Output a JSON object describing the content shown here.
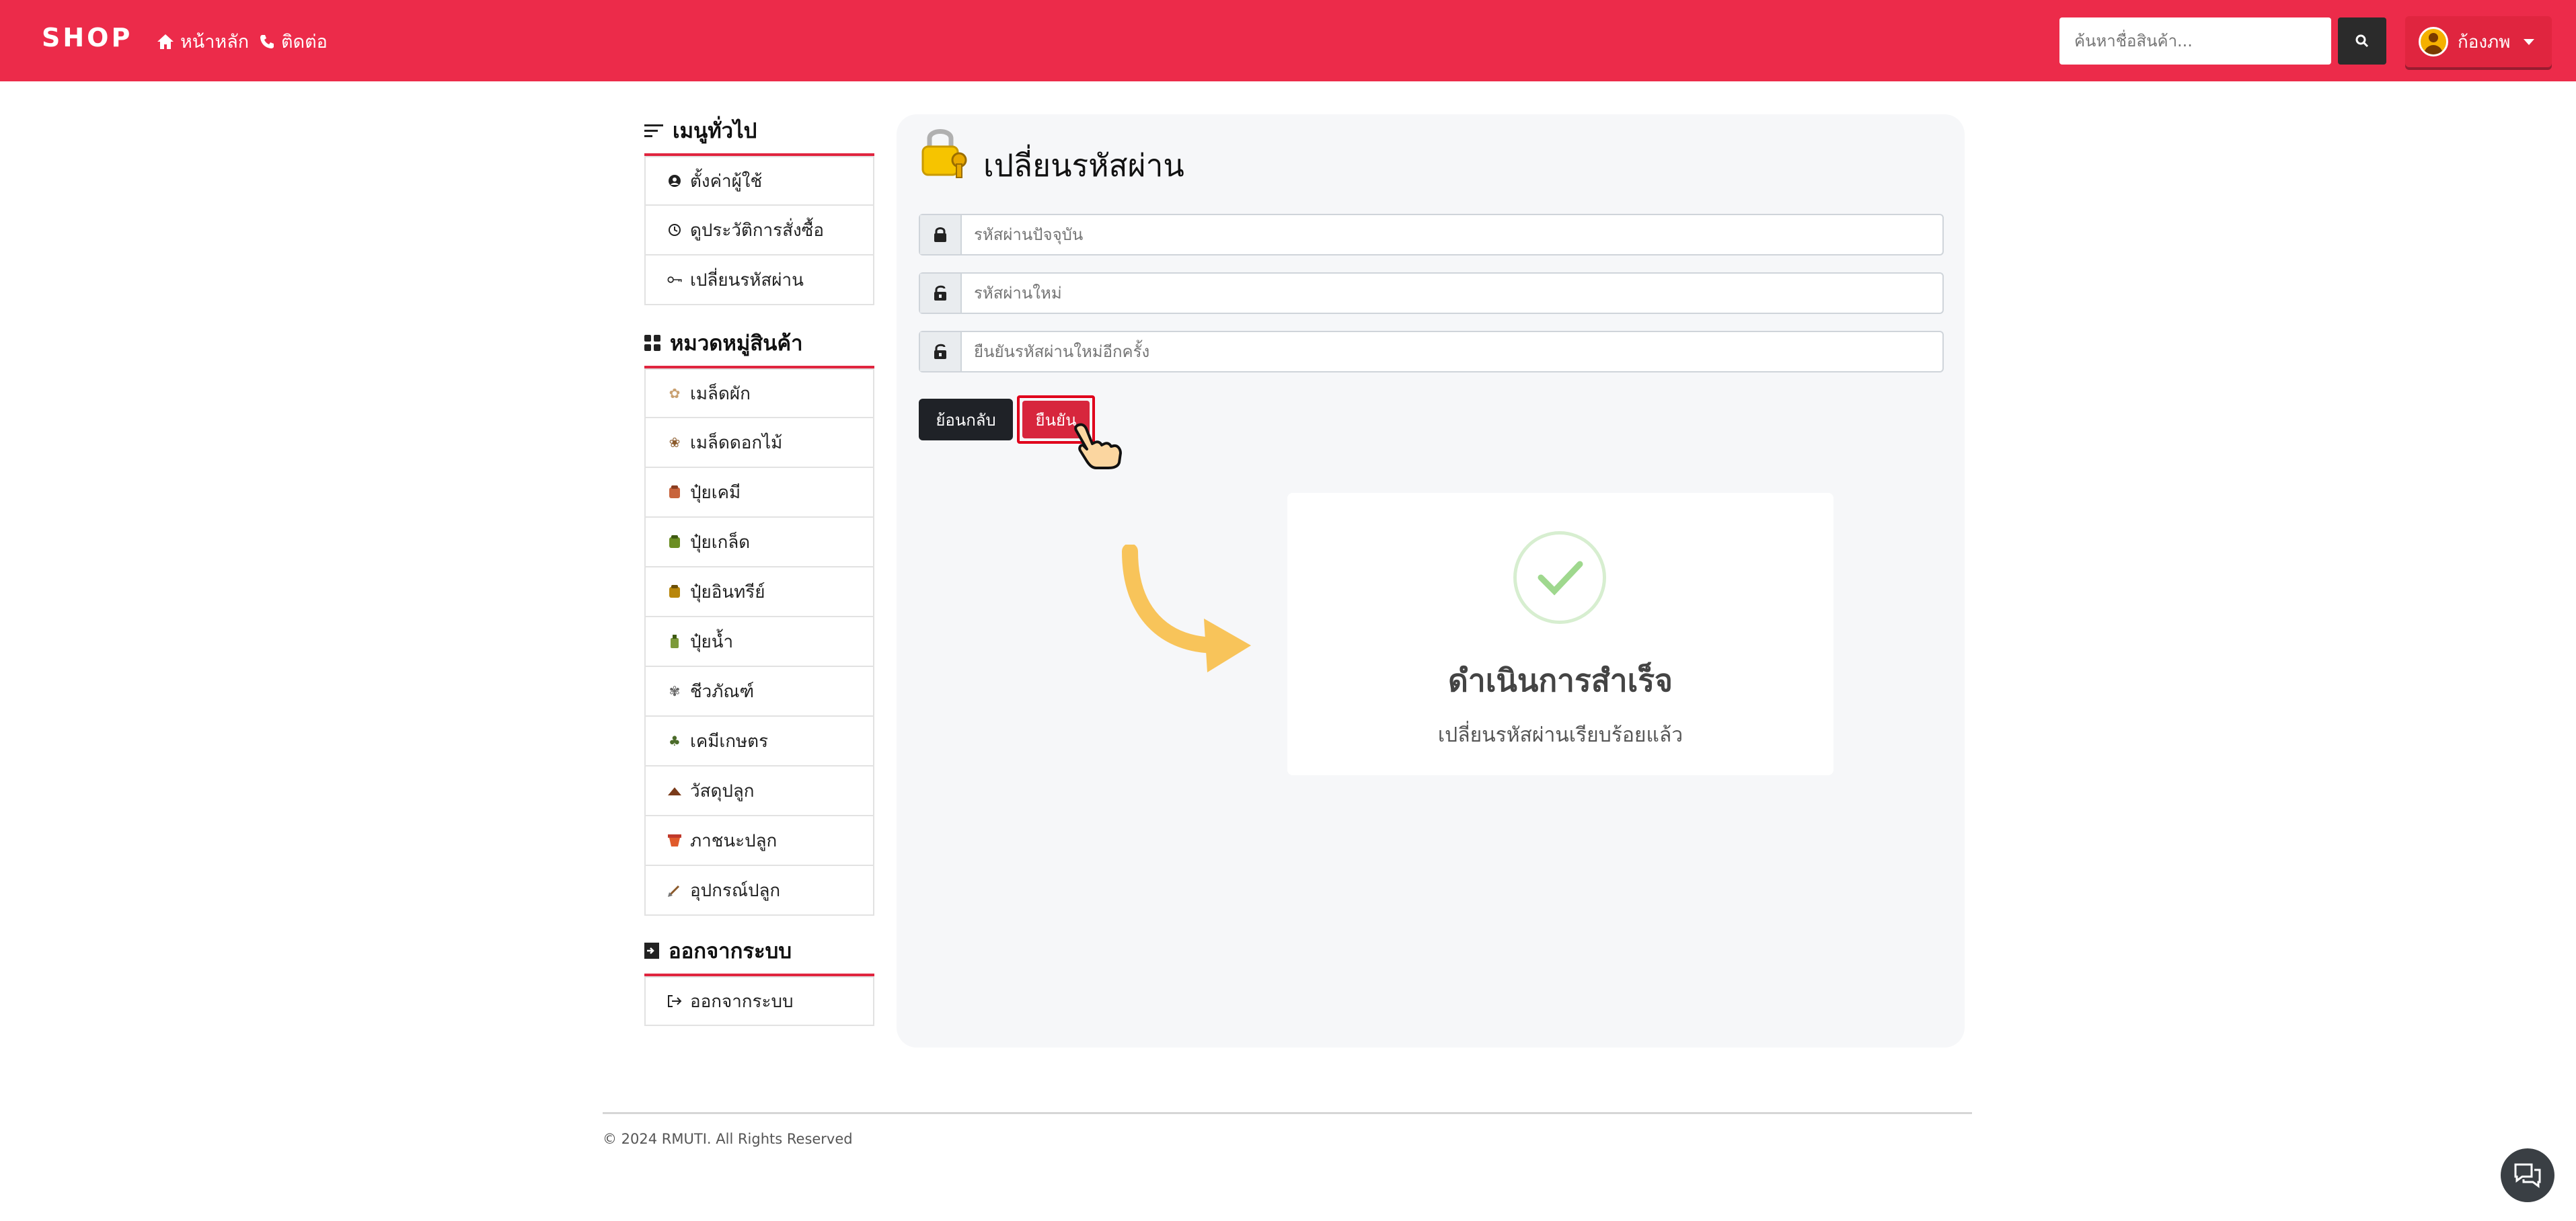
{
  "navbar": {
    "brand": "SHOP",
    "links": [
      {
        "label": "หน้าหลัก",
        "icon": "home-icon"
      },
      {
        "label": "ติดต่อ",
        "icon": "phone-icon"
      }
    ],
    "search_placeholder": "ค้นหาชื่อสินค้า...",
    "user_name": "ก้องภพ"
  },
  "sidebar": {
    "general": {
      "title": "เมนูทั่วไป",
      "items": [
        "ตั้งค่าผู้ใช้",
        "ดูประวัติการสั่งซื้อ",
        "เปลี่ยนรหัสผ่าน"
      ]
    },
    "categories": {
      "title": "หมวดหมู่สินค้า",
      "items": [
        "เมล็ดผัก",
        "เมล็ดดอกไม้",
        "ปุ๋ยเคมี",
        "ปุ๋ยเกล็ด",
        "ปุ๋ยอินทรีย์",
        "ปุ๋ยน้ำ",
        "ชีวภัณฑ์",
        "เคมีเกษตร",
        "วัสดุปลูก",
        "ภาชนะปลูก",
        "อุปกรณ์ปลูก"
      ]
    },
    "logout": {
      "title": "ออกจากระบบ",
      "items": [
        "ออกจากระบบ"
      ]
    }
  },
  "main": {
    "title": "เปลี่ยนรหัสผ่าน",
    "fields": [
      {
        "placeholder": "รหัสผ่านปัจจุบัน",
        "value": ""
      },
      {
        "placeholder": "รหัสผ่านใหม่",
        "value": ""
      },
      {
        "placeholder": "ยืนยันรหัสผ่านใหม่อีกครั้ง",
        "value": ""
      }
    ],
    "back_label": "ย้อนกลับ",
    "confirm_label": "ยืนยัน"
  },
  "success": {
    "title": "ดำเนินการสำเร็จ",
    "message": "เปลี่ยนรหัสผ่านเรียบร้อยแล้ว"
  },
  "footer": {
    "copyright": "© 2024 RMUTI. All Rights Reserved"
  },
  "colors": {
    "navbar": "#ec2b4a",
    "accent": "#e0253f",
    "dark_button": "#1f2227",
    "success_check": "#9fd88e"
  }
}
